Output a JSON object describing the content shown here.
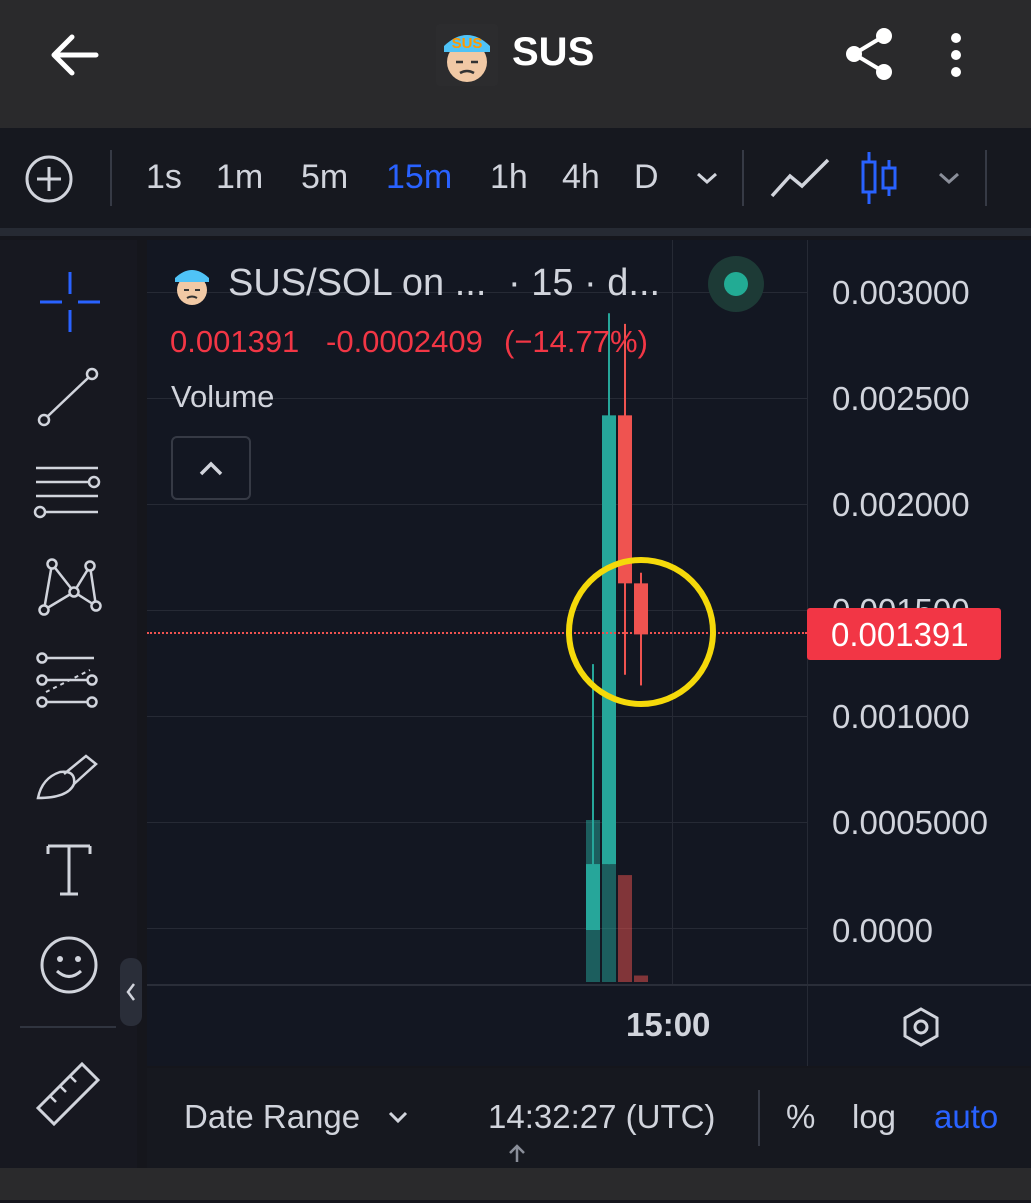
{
  "header": {
    "title": "SUS",
    "logo_text": "SUS"
  },
  "timeframes": [
    "1s",
    "1m",
    "5m",
    "15m",
    "1h",
    "4h",
    "D"
  ],
  "active_timeframe": "15m",
  "legend": {
    "symbol": "SUS/SOL on ...",
    "interval": "· 15 · d...",
    "price": "0.001391",
    "change": "-0.0002409",
    "change_pct": "(−14.77%)",
    "volume_label": "Volume"
  },
  "price_axis": [
    "0.003000",
    "0.002500",
    "0.002000",
    "0.001500",
    "0.001000",
    "0.0005000",
    "0.0000"
  ],
  "price_badge": "0.001391",
  "time_label": "15:00",
  "bottom": {
    "date_range": "Date Range",
    "clock": "14:32:27 (UTC)",
    "percent": "%",
    "log": "log",
    "auto": "auto"
  },
  "colors": {
    "up": "#26a69a",
    "down": "#ef5350",
    "accent": "#2962ff",
    "highlight_circle": "#f5d90a"
  },
  "chart_data": {
    "type": "candlestick",
    "interval": "15m",
    "ylim": [
      0,
      0.003
    ],
    "candles": [
      {
        "open": 0.0,
        "high": 0.00125,
        "low": 0.0,
        "close": 0.00031,
        "volume": 0.0005
      },
      {
        "open": 0.00031,
        "high": 0.0029,
        "low": 0.00031,
        "close": 0.00242,
        "volume": 0.0005
      },
      {
        "open": 0.00242,
        "high": 0.00285,
        "low": 0.0012,
        "close": 0.00163,
        "volume": 0.00033
      },
      {
        "open": 0.00163,
        "high": 0.00168,
        "low": 0.00115,
        "close": 0.00139,
        "volume": 2e-05
      }
    ],
    "last_price": 0.001391
  }
}
